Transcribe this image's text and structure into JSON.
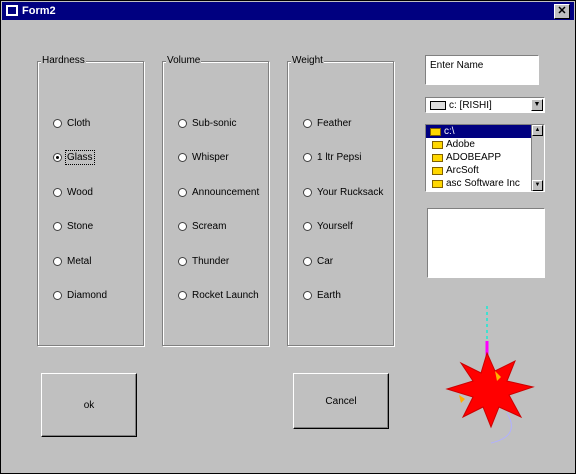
{
  "window": {
    "title": "Form2",
    "close_glyph": "✕"
  },
  "hardness": {
    "title": "Hardness",
    "options": [
      {
        "label": "Cloth",
        "checked": false
      },
      {
        "label": "Glass",
        "checked": true
      },
      {
        "label": "Wood",
        "checked": false
      },
      {
        "label": "Stone",
        "checked": false
      },
      {
        "label": "Metal",
        "checked": false
      },
      {
        "label": "Diamond",
        "checked": false
      }
    ]
  },
  "volume": {
    "title": "Volume",
    "options": [
      {
        "label": "Sub-sonic",
        "checked": false
      },
      {
        "label": "Whisper",
        "checked": false
      },
      {
        "label": "Announcement",
        "checked": false
      },
      {
        "label": "Scream",
        "checked": false
      },
      {
        "label": "Thunder",
        "checked": false
      },
      {
        "label": "Rocket Launch",
        "checked": false
      }
    ]
  },
  "weight": {
    "title": "Weight",
    "options": [
      {
        "label": "Feather",
        "checked": false
      },
      {
        "label": "1 ltr Pepsi",
        "checked": false
      },
      {
        "label": "Your Rucksack",
        "checked": false
      },
      {
        "label": "Yourself",
        "checked": false
      },
      {
        "label": "Car",
        "checked": false
      },
      {
        "label": "Earth",
        "checked": false
      }
    ]
  },
  "name_input": {
    "value": "Enter Name"
  },
  "drive_combo": {
    "value": "c: [RISHI]",
    "icon": "drive-icon"
  },
  "dir_list": {
    "items": [
      {
        "label": "c:\\",
        "selected": true
      },
      {
        "label": "Adobe",
        "selected": false
      },
      {
        "label": "ADOBEAPP",
        "selected": false
      },
      {
        "label": "ArcSoft",
        "selected": false
      },
      {
        "label": "asc Software Inc",
        "selected": false
      }
    ]
  },
  "buttons": {
    "ok_label": "ok",
    "cancel_label": "Cancel"
  },
  "colors": {
    "titlebar": "#000080",
    "face": "#c0c0c0",
    "starburst": "#ff0000",
    "starburst_accent": "#ffb000"
  }
}
